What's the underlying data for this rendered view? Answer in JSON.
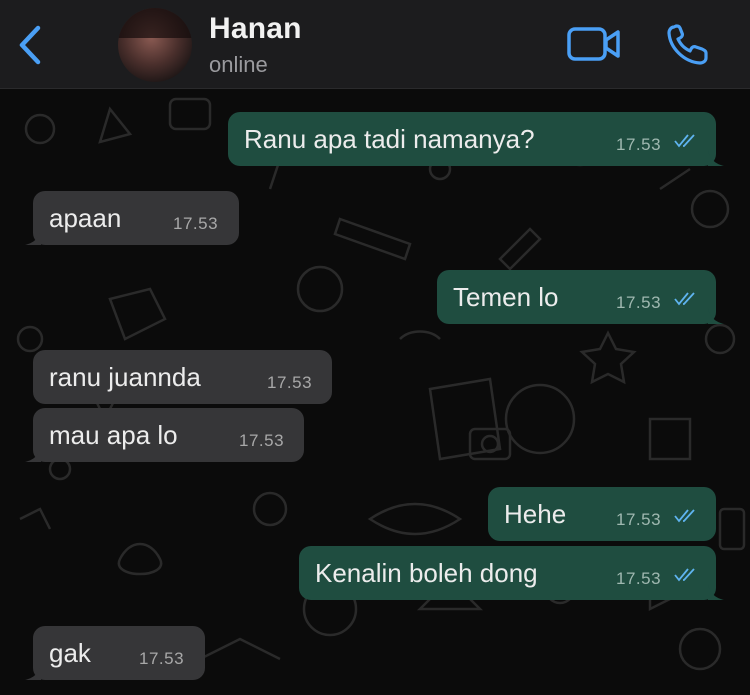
{
  "header": {
    "contact_name": "Hanan",
    "status": "online",
    "back_icon": "chevron-left-icon",
    "video_icon": "video-camera-icon",
    "call_icon": "phone-icon",
    "accent_color": "#4a9ff5"
  },
  "messages": [
    {
      "direction": "outgoing",
      "text": "Ranu apa tadi namanya?",
      "time": "17.53",
      "read": true
    },
    {
      "direction": "incoming",
      "text": "apaan",
      "time": "17.53"
    },
    {
      "direction": "outgoing",
      "text": "Temen lo",
      "time": "17.53",
      "read": true
    },
    {
      "direction": "incoming",
      "text": "ranu juannda",
      "time": "17.53"
    },
    {
      "direction": "incoming",
      "text": "mau apa lo",
      "time": "17.53"
    },
    {
      "direction": "outgoing",
      "text": "Hehe",
      "time": "17.53",
      "read": true
    },
    {
      "direction": "outgoing",
      "text": "Kenalin boleh dong",
      "time": "17.53",
      "read": true
    },
    {
      "direction": "incoming",
      "text": "gak",
      "time": "17.53"
    }
  ],
  "colors": {
    "incoming_bubble": "#363638",
    "outgoing_bubble": "#1f4d40",
    "read_ticks": "#5fb4f0"
  }
}
